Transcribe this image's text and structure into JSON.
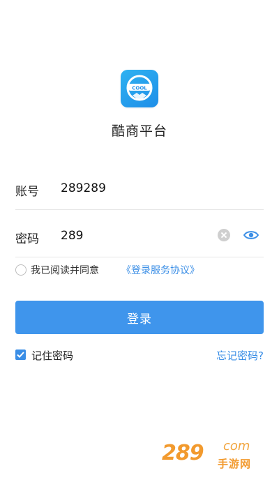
{
  "app": {
    "name": "酷商平台",
    "logo_text": "COOL"
  },
  "form": {
    "account_label": "账号",
    "account_value": "289289",
    "password_label": "密码",
    "password_value": "289"
  },
  "agreement": {
    "checked": false,
    "text": "我已阅读并同意",
    "link": "《登录服务协议》"
  },
  "login_button": "登录",
  "remember": {
    "checked": true,
    "label": "记住密码"
  },
  "forgot_password": "忘记密码?",
  "watermark": {
    "number": "289",
    "domain": "com",
    "brand": "手游网"
  },
  "colors": {
    "accent": "#3f95ec",
    "link": "#3a8ee6",
    "watermark": "#f29a2e"
  },
  "icons": {
    "clear": "clear-icon",
    "eye": "eye-icon",
    "check": "check-icon"
  }
}
